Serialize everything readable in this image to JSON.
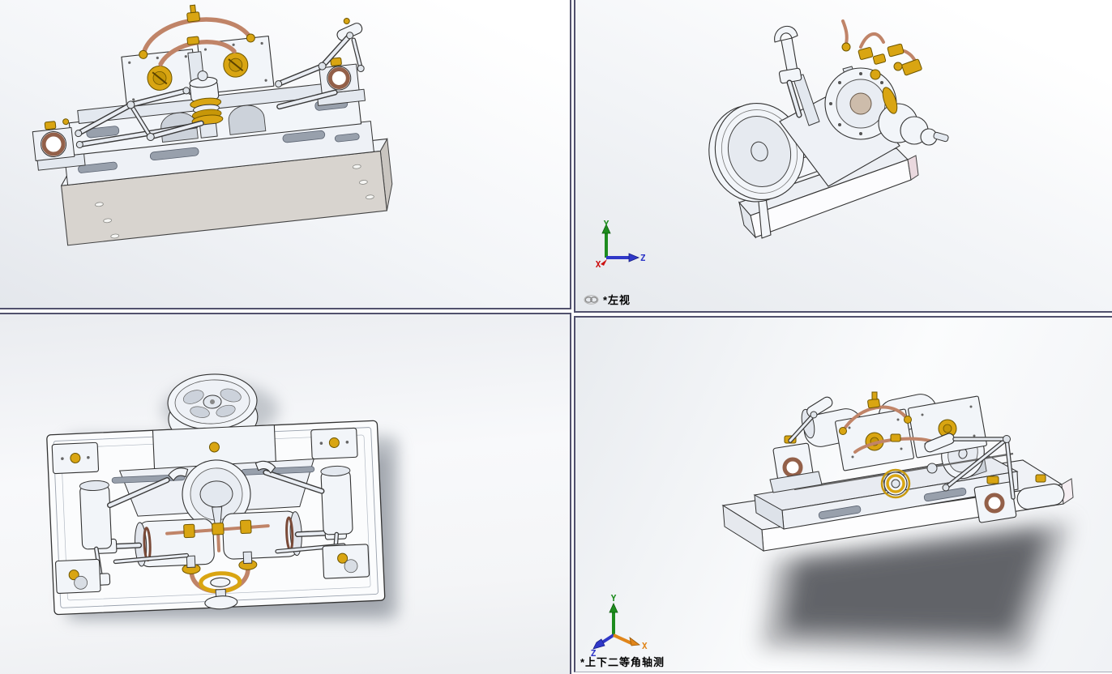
{
  "viewports": {
    "top_left": {},
    "top_right": {
      "label": "*左视",
      "link_icon": "link-icon"
    },
    "bottom_left": {},
    "bottom_right": {
      "label": "*上下二等角轴测"
    }
  },
  "triads": {
    "left_view": {
      "x": "X",
      "y": "Y",
      "z": "Z"
    },
    "isometric": {
      "x": "X",
      "y": "Y",
      "z": "Z"
    }
  },
  "colors": {
    "axis_x_left_view": "#cc1111",
    "axis_x_isometric": "#e0851a",
    "axis_y": "#1e8c1e",
    "axis_z": "#3038c8",
    "viewport_divider": "#51516d",
    "viewport_background_top": "#ffffff",
    "viewport_background_bottom": "#e6e9ed",
    "label_text": "#000000",
    "brass_fittings": "#d9a512",
    "copper_pipe": "#c08468",
    "base_plate": "#d8d4cf",
    "metal_parts": "#f2f5f9",
    "model_shadow": "#55565a"
  }
}
